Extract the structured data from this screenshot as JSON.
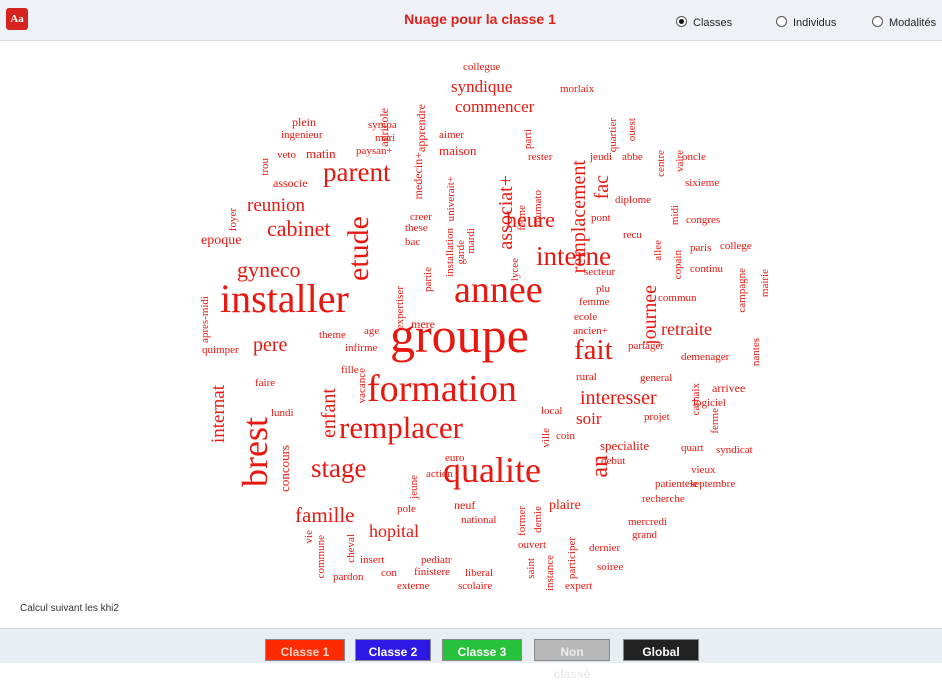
{
  "header": {
    "app_icon": "Aa",
    "title": "Nuage pour la classe 1",
    "options": [
      {
        "label": "Classes",
        "selected": true
      },
      {
        "label": "Individus",
        "selected": false
      },
      {
        "label": "Modalités",
        "selected": false
      }
    ]
  },
  "colors": {
    "word": "#e8170f",
    "classe1": "#ff2a00",
    "classe2": "#2d18e6",
    "classe3": "#27c23c",
    "non_classe": "#b8b8b8",
    "global": "#222222"
  },
  "cloud": {
    "words": [
      "collegue",
      "syndique",
      "agricole",
      "apprendre",
      "morlaix",
      "commencer",
      "plein",
      "sympa",
      "medecin+",
      "quartier",
      "ouest",
      "ingenieur",
      "mari",
      "aimer",
      "parti",
      "trou",
      "veto",
      "matin",
      "paysan+",
      "maison",
      "remplacement",
      "rester",
      "jeudi",
      "abbe",
      "centre",
      "vaire",
      "oncle",
      "parent",
      "associe",
      "univerait+",
      "associat+",
      "fac",
      "sixieme",
      "reunion",
      "foyer",
      "rhumato",
      "ferme",
      "diplome",
      "midi",
      "cabinet",
      "creer",
      "etude",
      "heure",
      "pont",
      "congres",
      "these",
      "bac",
      "installation",
      "mardi",
      "garde",
      "allee",
      "epoque",
      "recu",
      "paris",
      "college",
      "interne",
      "lycee",
      "copain",
      "gyneco",
      "expertiser",
      "partie",
      "secteur",
      "continu",
      "campagne",
      "mairie",
      "installer",
      "annee",
      "plu",
      "journee",
      "apres-midi",
      "mere",
      "femme",
      "commun",
      "ecole",
      "groupe",
      "theme",
      "age",
      "ancien+",
      "retraite",
      "nantes",
      "quimper",
      "pere",
      "infirme",
      "fait",
      "partager",
      "demenager",
      "fille",
      "vacance",
      "rural",
      "general",
      "internat",
      "faire",
      "formation",
      "arrivee",
      "carhaix",
      "interesser",
      "lundi",
      "local",
      "projet",
      "logiciel",
      "ferme",
      "enfant",
      "soir",
      "remplacer",
      "ville",
      "coin",
      "specialite",
      "quart",
      "syndicat",
      "brest",
      "concours",
      "euro",
      "action",
      "debut",
      "vieux",
      "stage",
      "jeune",
      "qualite",
      "patientele",
      "septembre",
      "an",
      "neuf",
      "recherche",
      "famille",
      "pole",
      "former",
      "demie",
      "plaire",
      "national",
      "mercredi",
      "grand",
      "vie",
      "hopital",
      "commune",
      "cheval",
      "participer",
      "ouvert",
      "dernier",
      "saint",
      "instance",
      "soiree",
      "insert",
      "pediatr",
      "con",
      "finistere",
      "liberal",
      "pardon",
      "externe",
      "scolaire",
      "expert"
    ]
  },
  "footer": {
    "note": "Calcul suivant les khi2"
  },
  "bottom": {
    "buttons": [
      "Classe 1",
      "Classe 2",
      "Classe 3",
      "Non classé",
      "Global"
    ]
  }
}
